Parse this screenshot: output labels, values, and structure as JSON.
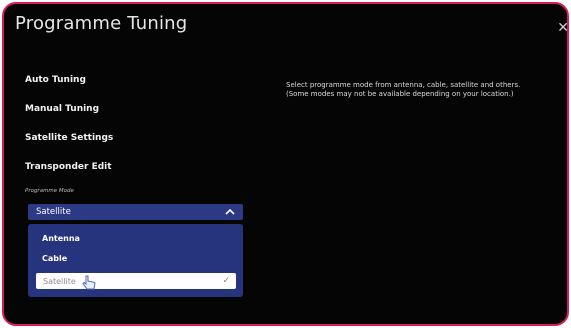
{
  "header": {
    "title": "Programme Tuning"
  },
  "menu": {
    "items": [
      {
        "label": "Auto Tuning"
      },
      {
        "label": "Manual Tuning"
      },
      {
        "label": "Satellite Settings"
      },
      {
        "label": "Transponder Edit"
      }
    ]
  },
  "programme_mode": {
    "label": "Programme Mode",
    "selected": "Satellite",
    "options": [
      "Antenna",
      "Cable",
      "Satellite"
    ]
  },
  "description": {
    "line1": "Select programme mode from antenna, cable, satellite and others.",
    "line2": "(Some modes may not be available depending on your location.)"
  },
  "icons": {
    "close": "close-icon",
    "chevron": "chevron-up-icon",
    "check": "check-icon",
    "cursor": "hand-pointer-icon"
  },
  "colors": {
    "frame_border": "#d81b5a",
    "background": "#050505",
    "select_bg": "#2c3a86",
    "dropdown_bg": "#26347d"
  }
}
